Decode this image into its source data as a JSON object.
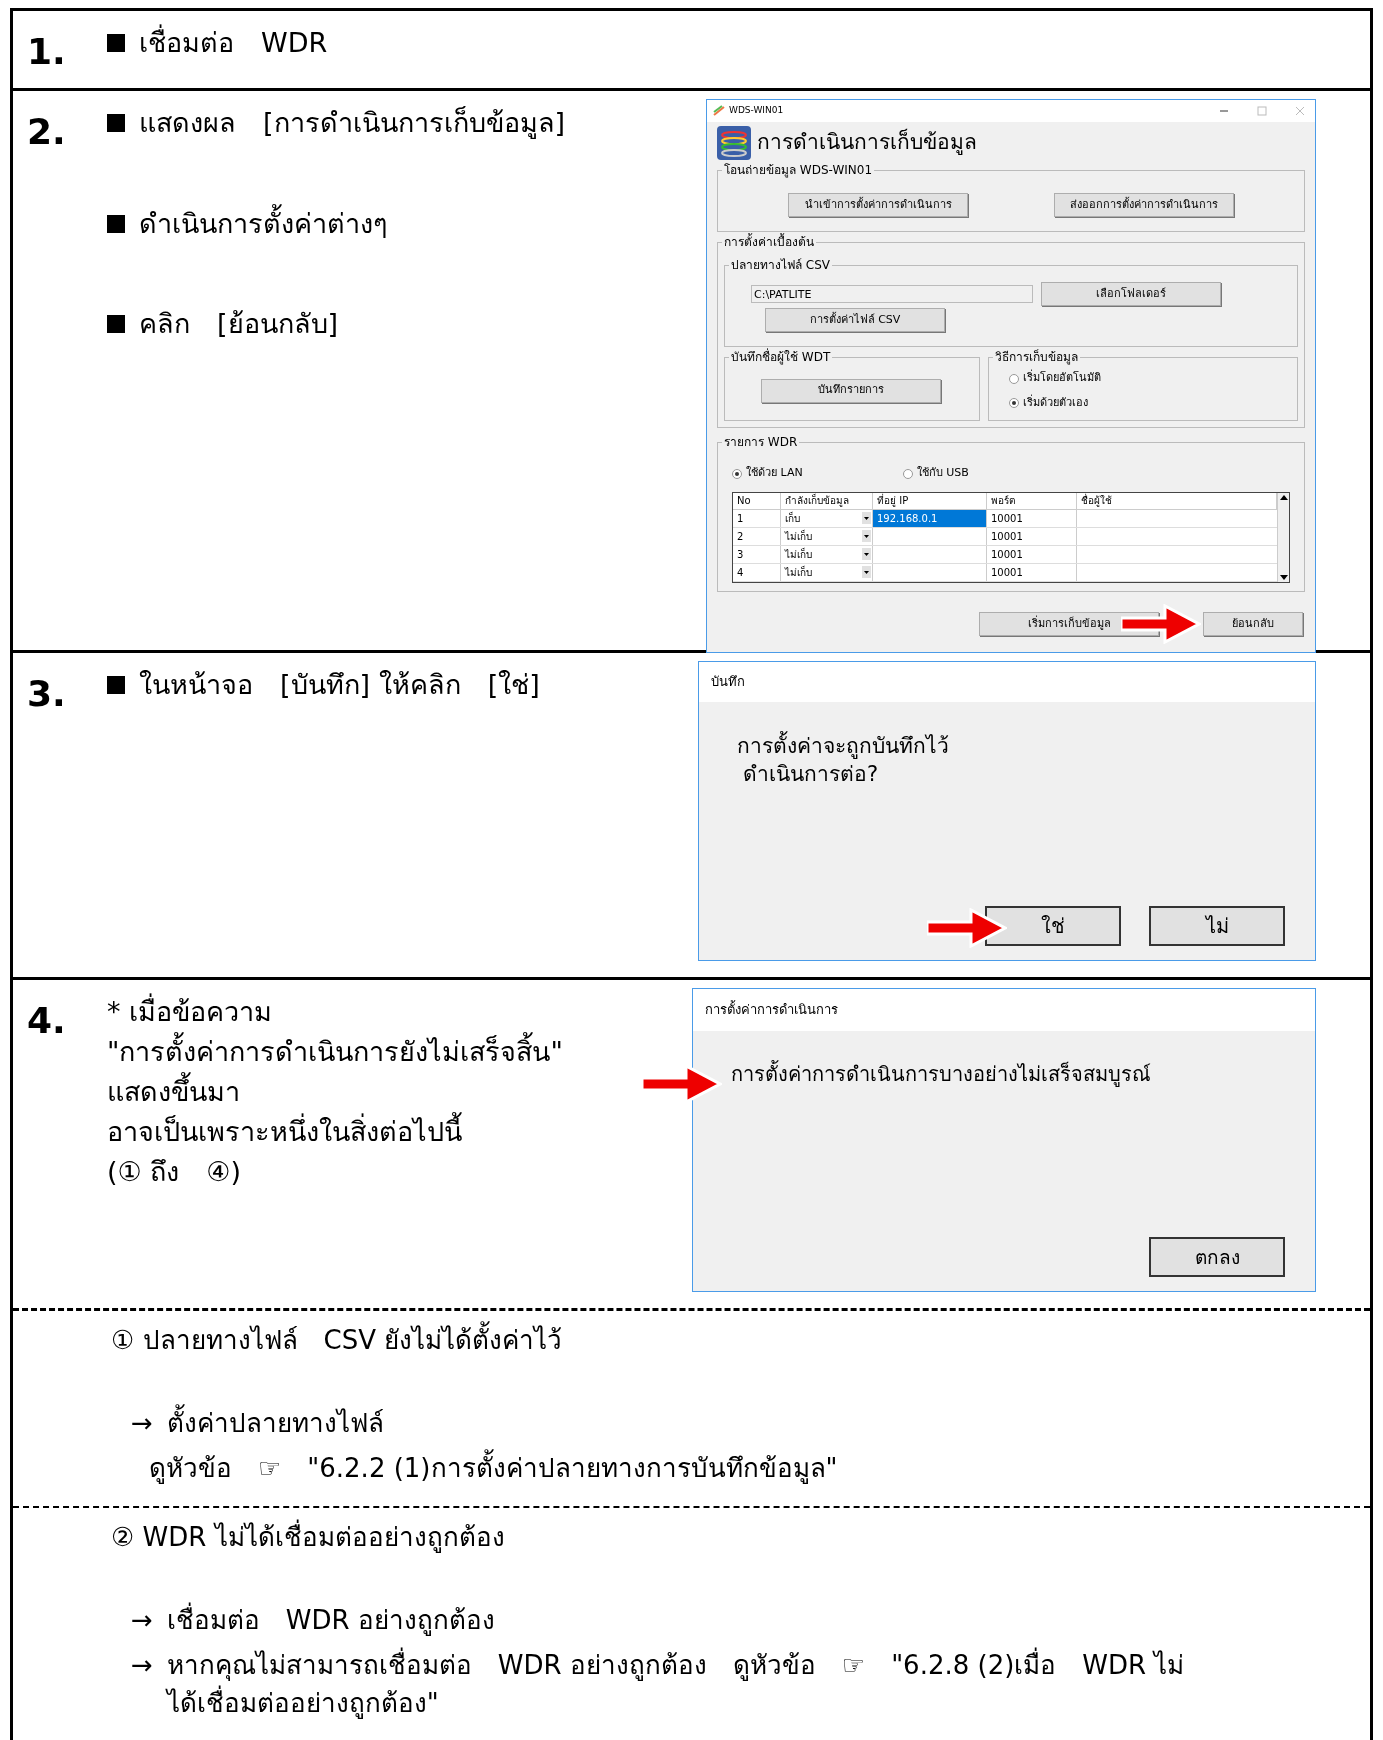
{
  "steps": [
    {
      "number": "1.",
      "lines": [
        {
          "kind": "bullet",
          "text": "เชื่อมต่อ　WDR"
        }
      ]
    },
    {
      "number": "2.",
      "lines": [
        {
          "kind": "bullet",
          "text": "แสดงผล　[การดำเนินการเก็บข้อมูล]"
        },
        {
          "kind": "bullet",
          "text": "ดำเนินการตั้งค่าต่างๆ"
        },
        {
          "kind": "bullet",
          "text": "คลิก　[ย้อนกลับ]"
        }
      ],
      "window": {
        "title": "WDS-WIN01",
        "heading": "การดำเนินการเก็บข้อมูล",
        "transfer": {
          "legend": "โอนถ่ายข้อมูล WDS-WIN01",
          "buttons": [
            "นำเข้าการตั้งค่าการดำเนินการ",
            "ส่งออกการตั้งค่าการดำเนินการ"
          ]
        },
        "initial": {
          "legend": "การตั้งค่าเบื้องต้น",
          "csv_legend": "ปลายทางไฟล์ CSV",
          "path": "C:\\PATLITE",
          "folder_button": "เลือกโฟลเดอร์",
          "csv_button": "การตั้งค่าไฟล์ CSV",
          "user_legend": "บันทึกชื่อผู้ใช้ WDT",
          "user_button": "บันทึกรายการ",
          "method_legend": "วิธีการเก็บข้อมูล",
          "methods": [
            {
              "label": "เริ่มโดยอัตโนมัติ",
              "selected": false
            },
            {
              "label": "เริ่มด้วยตัวเอง",
              "selected": true
            }
          ]
        },
        "wdr": {
          "legend": "รายการ WDR",
          "connections": [
            {
              "label": "ใช้ด้วย LAN",
              "selected": true
            },
            {
              "label": "ใช้กับ USB",
              "selected": false
            }
          ],
          "columns": [
            "No",
            "กำลังเก็บข้อมูล",
            "ที่อยู่ IP",
            "พอร์ต",
            "ชื่อผู้ใช้"
          ],
          "rows": [
            {
              "no": "1",
              "collect": "เก็บ",
              "ip": "192.168.0.1",
              "port": "10001",
              "selected": true
            },
            {
              "no": "2",
              "collect": "ไม่เก็บ",
              "ip": "",
              "port": "10001",
              "selected": false
            },
            {
              "no": "3",
              "collect": "ไม่เก็บ",
              "ip": "",
              "port": "10001",
              "selected": false
            },
            {
              "no": "4",
              "collect": "ไม่เก็บ",
              "ip": "",
              "port": "10001",
              "selected": false
            }
          ]
        },
        "buttons": [
          "เริ่มการเก็บข้อมูล",
          "ย้อนกลับ"
        ]
      }
    },
    {
      "number": "3.",
      "lines": [
        {
          "kind": "bullet",
          "text": "ในหน้าจอ　[บันทึก] ให้คลิก　[ใช่]"
        }
      ],
      "dialog": {
        "title": "บันทึก",
        "message": [
          "การตั้งค่าจะถูกบันทึกไว้",
          "ดำเนินการต่อ?"
        ],
        "buttons": [
          "ใช่",
          "ไม่"
        ]
      }
    },
    {
      "number": "4.",
      "lines": [
        {
          "kind": "text",
          "text": "* เมื่อข้อความ"
        },
        {
          "kind": "text",
          "text": "\"การตั้งค่าการดำเนินการยังไม่เสร็จสิ้น\""
        },
        {
          "kind": "text",
          "text": "แสดงขึ้นมา"
        },
        {
          "kind": "text",
          "text": "อาจเป็นเพราะหนึ่งในสิ่งต่อไปนี้"
        },
        {
          "kind": "text",
          "text": "(① ถึง　④)"
        }
      ],
      "message_box": {
        "title": "การตั้งค่าการดำเนินการ",
        "message": "การตั้งค่าการดำเนินการบางอย่างไม่เสร็จสมบูรณ์",
        "button": "ตกลง"
      }
    }
  ],
  "causes": [
    {
      "title": "① ปลายทางไฟล์　CSV ยังไม่ได้ตั้งค่าไว้",
      "remedies": [
        {
          "kind": "arrow",
          "text": "ตั้งค่าปลายทางไฟล์"
        },
        {
          "kind": "ref",
          "text": "ดูหัวข้อ　☞　\"6.2.2 (1)การตั้งค่าปลายทางการบันทึกข้อมูล\""
        }
      ]
    },
    {
      "title": "② WDR ไม่ได้เชื่อมต่ออย่างถูกต้อง",
      "remedies": [
        {
          "kind": "arrow",
          "text": "เชื่อมต่อ　WDR อย่างถูกต้อง"
        },
        {
          "kind": "arrow",
          "text": "หากคุณไม่สามารถเชื่อมต่อ　WDR อย่างถูกต้อง　ดูหัวข้อ　☞　\"6.2.8 (2)เมื่อ　WDR ไม่ได้เชื่อมต่ออย่างถูกต้อง\""
        }
      ]
    }
  ],
  "arrow_glyph": "→"
}
